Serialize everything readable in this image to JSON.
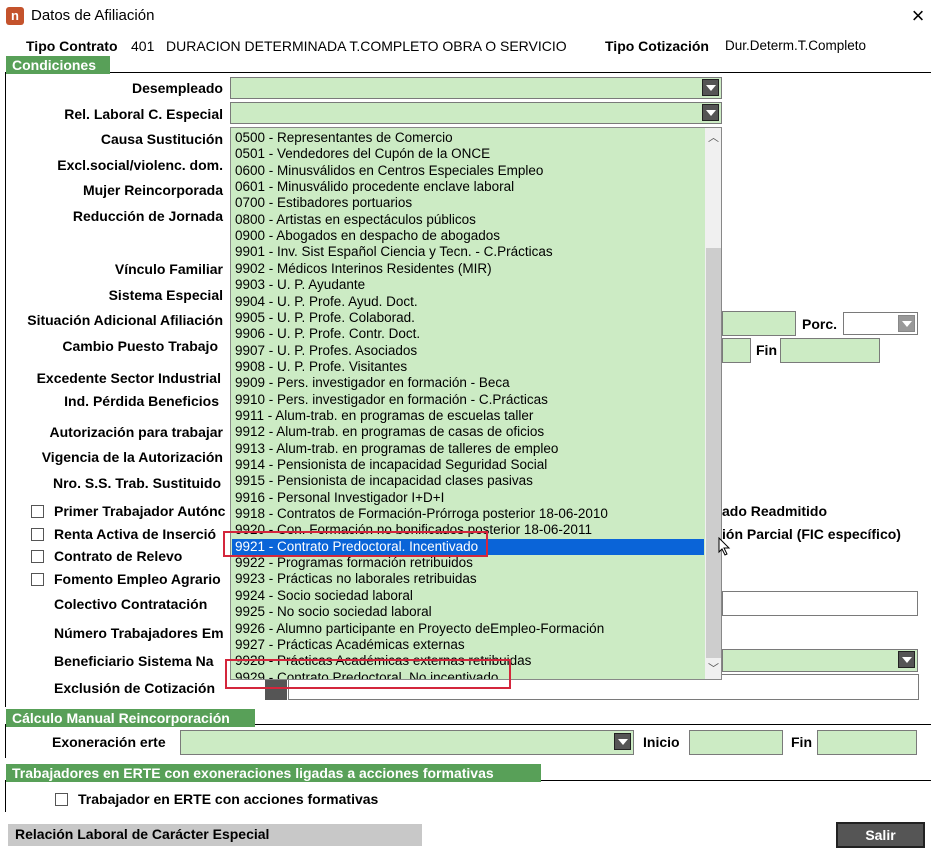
{
  "window": {
    "title": "Datos de Afiliación",
    "icon_letter": "n"
  },
  "header": {
    "tipo_contrato_label": "Tipo Contrato",
    "tipo_contrato_code": "401",
    "tipo_contrato_desc": "DURACION DETERMINADA T.COMPLETO OBRA O SERVICIO",
    "tipo_cotizacion_label": "Tipo Cotización",
    "tipo_cotizacion_value": "Dur.Determ.T.Completo"
  },
  "condiciones": {
    "section_title": "Condiciones",
    "labels": {
      "desempleado": "Desempleado",
      "rel_laboral": "Rel. Laboral C. Especial",
      "causa_sustitucion": "Causa Sustitución",
      "excl_social": "Excl.social/violenc. dom.",
      "mujer_reincorporada": "Mujer Reincorporada",
      "reduccion_jornada": "Reducción de Jornada",
      "vinculo_familiar": "Vínculo Familiar",
      "sistema_especial": "Sistema Especial",
      "situacion_adicional": "Situación Adicional Afiliación",
      "cambio_puesto": "Cambio Puesto Trabajo",
      "excedente": "Excedente Sector Industrial",
      "ind_perdida": "Ind. Pérdida Beneficios",
      "autorizacion": "Autorización para trabajar",
      "vigencia": "Vigencia de la Autorización",
      "nro_ss": "Nro. S.S. Trab. Sustituido",
      "colectivo": "Colectivo Contratación",
      "numero_trabajadores": "Número Trabajadores Em",
      "beneficiario": "Beneficiario Sistema Na",
      "exclusion": "Exclusión de Cotización",
      "porc": "Porc.",
      "fin": "Fin"
    },
    "checkboxes": {
      "primer_trabajador": "Primer Trabajador Autónc",
      "renta_activa": "Renta Activa de Inserció",
      "contrato_relevo": "Contrato de Relevo",
      "fomento_empleo": "Fomento Empleo Agrario",
      "readmitido_tail": "ado Readmitido",
      "parcial_tail": "ión Parcial (FIC específico)"
    }
  },
  "dropdown_list": {
    "items": [
      "0500 - Representantes de Comercio",
      "0501 - Vendedores del Cupón de la ONCE",
      "0600 - Minusválidos en Centros Especiales Empleo",
      "0601 - Minusválido procedente enclave laboral",
      "0700 - Estibadores portuarios",
      "0800 - Artistas en espectáculos públicos",
      "0900 - Abogados en despacho de abogados",
      "9901 - Inv. Sist Español Ciencia y Tecn. - C.Prácticas",
      "9902 - Médicos Interinos Residentes (MIR)",
      "9903 - U. P. Ayudante",
      "9904 - U. P. Profe. Ayud. Doct.",
      "9905 - U. P. Profe. Colaborad.",
      "9906 - U. P. Profe. Contr. Doct.",
      "9907 - U. P. Profes. Asociados",
      "9908 - U. P. Profe. Visitantes",
      "9909 - Pers. investigador en formación - Beca",
      "9910 - Pers. investigador en formación - C.Prácticas",
      "9911 - Alum-trab. en programas de escuelas taller",
      "9912 - Alum-trab. en programas de casas de oficios",
      "9913 - Alum-trab. en programas de talleres de empleo",
      "9914 - Pensionista de incapacidad Seguridad Social",
      "9915 - Pensionista de incapacidad clases pasivas",
      "9916 - Personal Investigador I+D+I",
      "9918 - Contratos de Formación-Prórroga posterior 18-06-2010",
      "9920 - Con. Formación no bonificados posterior 18-06-2011",
      "9921 - Contrato Predoctoral. Incentivado",
      "9922 - Programas formación retribuidos",
      "9923 - Prácticas no laborales retribuidas",
      "9924 - Socio sociedad laboral",
      "9925 - No socio sociedad laboral",
      "9926 - Alumno participante en Proyecto deEmpleo-Formación",
      "9927 - Prácticas Académicas externas",
      "9928 - Prácticas Académicas externas retribuidas",
      "9929 - Contrato Predoctoral. No incentivado"
    ],
    "selected_index": 25
  },
  "calculo_manual": {
    "section_title": "Cálculo Manual Reincorporación",
    "exoneracion_label": "Exoneración erte",
    "inicio_label": "Inicio",
    "fin_label": "Fin"
  },
  "erte": {
    "section_title": "Trabajadores en ERTE con exoneraciones ligadas a acciones formativas",
    "checkbox_label": "Trabajador en ERTE con acciones formativas"
  },
  "footer": {
    "status_text": "Relación Laboral de Carácter Especial",
    "salir_label": "Salir"
  }
}
